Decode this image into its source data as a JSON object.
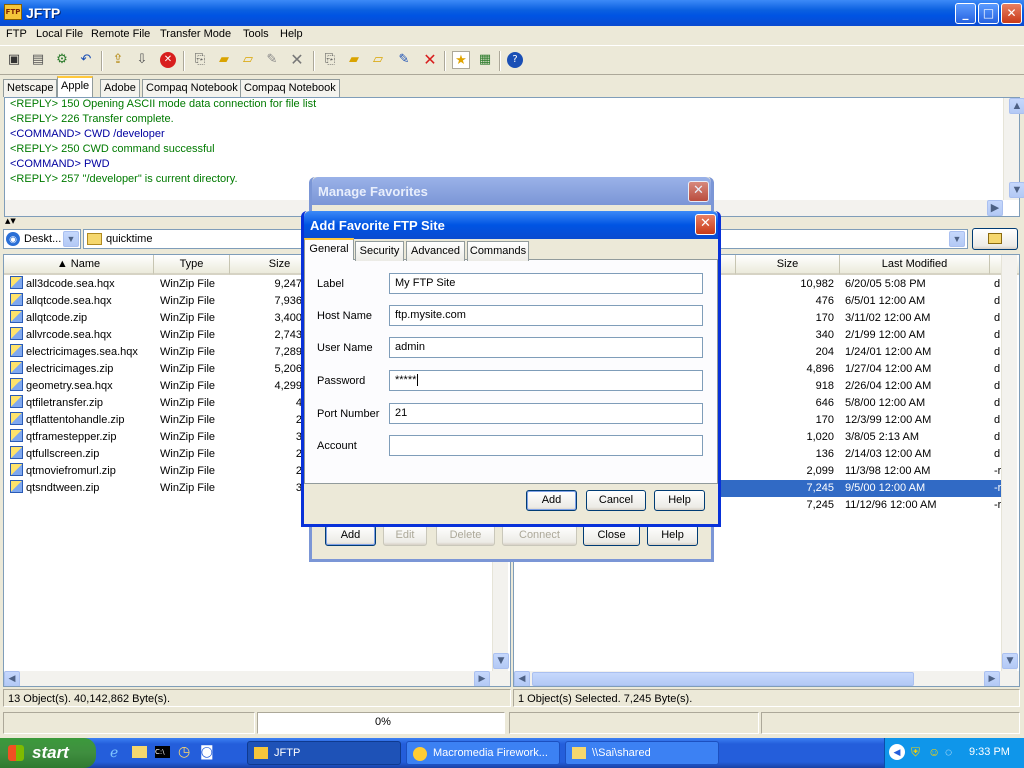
{
  "window": {
    "title": "JFTP",
    "app_icon": "FTP"
  },
  "menu": [
    "FTP",
    "Local File",
    "Remote File",
    "Transfer Mode",
    "Tools",
    "Help"
  ],
  "site_tabs": [
    "Netscape",
    "Apple",
    "Adobe",
    "Compaq Notebook",
    "Compaq Notebook"
  ],
  "active_site_tab": "Apple",
  "log": [
    {
      "text": "<REPLY> 150 Opening ASCII mode data connection for file list",
      "kind": "reply"
    },
    {
      "text": "<REPLY> 226 Transfer complete.",
      "kind": "reply"
    },
    {
      "text": "<COMMAND> CWD /developer",
      "kind": "command"
    },
    {
      "text": "<REPLY> 250 CWD command successful",
      "kind": "reply"
    },
    {
      "text": "<COMMAND> PWD",
      "kind": "command"
    },
    {
      "text": "<REPLY> 257 \"/developer\" is current directory.",
      "kind": "reply"
    }
  ],
  "colors": {
    "reply": "#007a00",
    "command": "#0000a0",
    "selection": "#316ac5",
    "title_blue": "#0054e3"
  },
  "local": {
    "drive": "Deskt...",
    "folder": "quicktime",
    "columns": [
      "Name",
      "Type",
      "Size"
    ],
    "files": [
      {
        "name": "all3dcode.sea.hqx",
        "type": "WinZip File",
        "size": "9,247"
      },
      {
        "name": "allqtcode.sea.hqx",
        "type": "WinZip File",
        "size": "7,936"
      },
      {
        "name": "allqtcode.zip",
        "type": "WinZip File",
        "size": "3,400"
      },
      {
        "name": "allvrcode.sea.hqx",
        "type": "WinZip File",
        "size": "2,743"
      },
      {
        "name": "electricimages.sea.hqx",
        "type": "WinZip File",
        "size": "7,289"
      },
      {
        "name": "electricimages.zip",
        "type": "WinZip File",
        "size": "5,206"
      },
      {
        "name": "geometry.sea.hqx",
        "type": "WinZip File",
        "size": "4,299"
      },
      {
        "name": "qtfiletransfer.zip",
        "type": "WinZip File",
        "size": "4"
      },
      {
        "name": "qtflattentohandle.zip",
        "type": "WinZip File",
        "size": "2"
      },
      {
        "name": "qtframestepper.zip",
        "type": "WinZip File",
        "size": "3"
      },
      {
        "name": "qtfullscreen.zip",
        "type": "WinZip File",
        "size": "2"
      },
      {
        "name": "qtmoviefromurl.zip",
        "type": "WinZip File",
        "size": "2"
      },
      {
        "name": "qtsndtween.zip",
        "type": "WinZip File",
        "size": "3"
      }
    ],
    "status": "13 Object(s). 40,142,862 Byte(s)."
  },
  "remote": {
    "columns": [
      "Size",
      "Last Modified"
    ],
    "files": [
      {
        "size": "10,982",
        "modified": "6/20/05 5:08 PM",
        "attr": "d"
      },
      {
        "size": "476",
        "modified": "6/5/01 12:00 AM",
        "attr": "d"
      },
      {
        "size": "170",
        "modified": "3/11/02 12:00 AM",
        "attr": "d"
      },
      {
        "size": "340",
        "modified": "2/1/99 12:00 AM",
        "attr": "d"
      },
      {
        "size": "204",
        "modified": "1/24/01 12:00 AM",
        "attr": "d"
      },
      {
        "size": "4,896",
        "modified": "1/27/04 12:00 AM",
        "attr": "d"
      },
      {
        "size": "918",
        "modified": "2/26/04 12:00 AM",
        "attr": "d"
      },
      {
        "size": "646",
        "modified": "5/8/00 12:00 AM",
        "attr": "d"
      },
      {
        "size": "170",
        "modified": "12/3/99 12:00 AM",
        "attr": "d"
      },
      {
        "size": "1,020",
        "modified": "3/8/05 2:13 AM",
        "attr": "d"
      },
      {
        "size": "136",
        "modified": "2/14/03 12:00 AM",
        "attr": "d"
      },
      {
        "size": "2,099",
        "modified": "11/3/98 12:00 AM",
        "attr": "-r"
      },
      {
        "size": "7,245",
        "modified": "9/5/00 12:00 AM",
        "attr": "-r",
        "selected": true
      },
      {
        "size": "7,245",
        "modified": "11/12/96 12:00 AM",
        "attr": "-r"
      }
    ],
    "status": "1 Object(s) Selected. 7,245 Byte(s)."
  },
  "progress": {
    "percent_label": "0%",
    "value": 0
  },
  "manage_favorites": {
    "title": "Manage Favorites",
    "buttons": [
      "Add",
      "Edit",
      "Delete",
      "Connect",
      "Close",
      "Help"
    ]
  },
  "add_favorite": {
    "title": "Add Favorite FTP Site",
    "tabs": [
      "General",
      "Security",
      "Advanced",
      "Commands"
    ],
    "fields": [
      {
        "label": "Label",
        "value": "My FTP Site"
      },
      {
        "label": "Host Name",
        "value": "ftp.mysite.com"
      },
      {
        "label": "User Name",
        "value": "admin"
      },
      {
        "label": "Password",
        "value": "*****"
      },
      {
        "label": "Port Number",
        "value": "21"
      },
      {
        "label": "Account",
        "value": ""
      }
    ],
    "buttons": {
      "add": "Add",
      "cancel": "Cancel",
      "help": "Help"
    }
  },
  "taskbar": {
    "start": "start",
    "tasks": [
      "JFTP",
      "Macromedia Firework...",
      "\\\\Sai\\shared"
    ],
    "clock": "9:33 PM"
  }
}
